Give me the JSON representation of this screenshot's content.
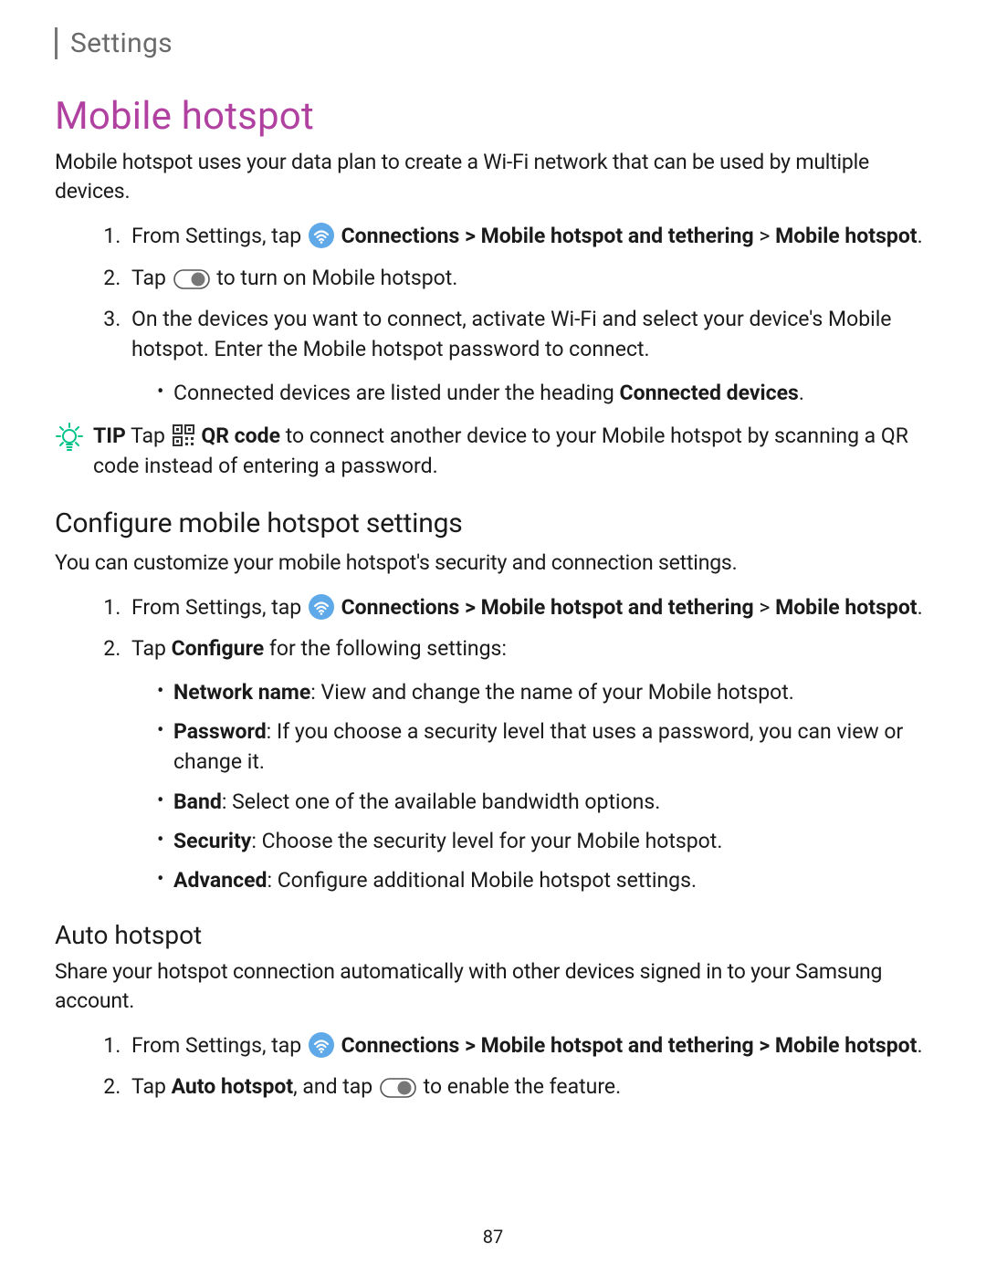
{
  "header": {
    "breadcrumb": "Settings"
  },
  "main": {
    "title": "Mobile hotspot",
    "intro": "Mobile hotspot uses your data plan to create a Wi-Fi network that can be used by multiple devices.",
    "steps": {
      "s1_pre": "From Settings, tap ",
      "s1_conn": "Connections > Mobile hotspot and tethering",
      "s1_gt": " > ",
      "s1_end": "Mobile hotspot",
      "s1_dot": ".",
      "s2_pre": "Tap ",
      "s2_end": " to turn on Mobile hotspot.",
      "s3": "On the devices you want to connect, activate Wi-Fi and select your device's Mobile hotspot. Enter the Mobile hotspot password to connect.",
      "s3_sub_pre": "Connected devices are listed under the heading ",
      "s3_sub_bold": "Connected devices",
      "s3_sub_dot": "."
    },
    "tip": {
      "label": "TIP",
      "pre": "  Tap ",
      "qr_bold": "QR code",
      "rest": " to connect another device to your Mobile hotspot by scanning a QR code instead of entering a password."
    }
  },
  "configure": {
    "heading": "Configure mobile hotspot settings",
    "intro": "You can customize your mobile hotspot's security and connection settings.",
    "steps": {
      "s1_pre": "From Settings, tap ",
      "s1_conn": "Connections > Mobile hotspot and tethering",
      "s1_gt": " > ",
      "s1_end": "Mobile hotspot",
      "s1_dot": ".",
      "s2_pre": "Tap ",
      "s2_bold": "Configure",
      "s2_end": " for the following settings:"
    },
    "options": {
      "net_name_b": "Network name",
      "net_name": ": View and change the name of your Mobile hotspot.",
      "pwd_b": "Password",
      "pwd": ": If you choose a security level that uses a password, you can view or change it.",
      "band_b": "Band",
      "band": ": Select one of the available bandwidth options.",
      "sec_b": "Security",
      "sec": ": Choose the security level for your Mobile hotspot.",
      "adv_b": "Advanced",
      "adv": ": Configure additional Mobile hotspot settings."
    }
  },
  "auto": {
    "heading": "Auto hotspot",
    "intro": "Share your hotspot connection automatically with other devices signed in to your Samsung account.",
    "steps": {
      "s1_pre": "From Settings, tap ",
      "s1_conn": "Connections > Mobile hotspot and tethering > Mobile hotspot",
      "s1_dot": ".",
      "s2_pre": "Tap ",
      "s2_bold": "Auto hotspot",
      "s2_mid": ", and tap ",
      "s2_end": " to enable the feature."
    }
  },
  "page_number": "87"
}
